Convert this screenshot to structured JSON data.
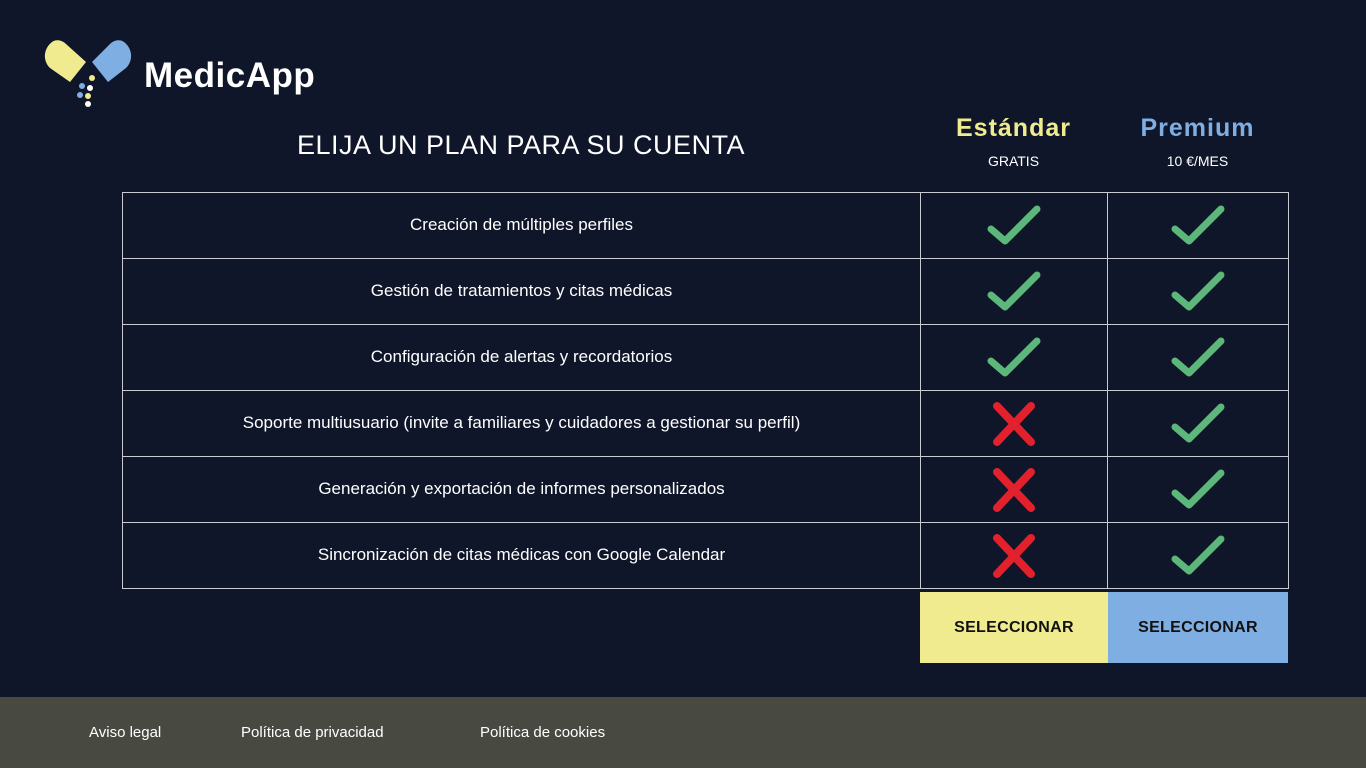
{
  "app": {
    "name": "MedicApp",
    "logo_icon": "pill-capsule-icon"
  },
  "colors": {
    "background": "#10162a",
    "standard_accent": "#f0eb8f",
    "premium_accent": "#7eaee2",
    "check": "#5cb87a",
    "cross": "#e3212d",
    "footer": "#484a42"
  },
  "heading": "ELIJA UN PLAN PARA SU CUENTA",
  "plans": {
    "standard": {
      "name": "Estándar",
      "price": "GRATIS",
      "button_label": "SELECCIONAR"
    },
    "premium": {
      "name": "Premium",
      "price": "10 €/MES",
      "button_label": "SELECCIONAR"
    }
  },
  "features": [
    {
      "label": "Creación de múltiples perfiles",
      "standard": true,
      "premium": true
    },
    {
      "label": "Gestión de tratamientos y citas médicas",
      "standard": true,
      "premium": true
    },
    {
      "label": "Configuración de alertas y recordatorios",
      "standard": true,
      "premium": true
    },
    {
      "label": "Soporte multiusuario (invite a familiares y cuidadores a gestionar su perfil)",
      "standard": false,
      "premium": true
    },
    {
      "label": "Generación y exportación de informes personalizados",
      "standard": false,
      "premium": true
    },
    {
      "label": "Sincronización de citas médicas con Google Calendar",
      "standard": false,
      "premium": true
    }
  ],
  "footer": {
    "links": [
      "Aviso legal",
      "Política de privacidad",
      "Política de cookies"
    ]
  }
}
